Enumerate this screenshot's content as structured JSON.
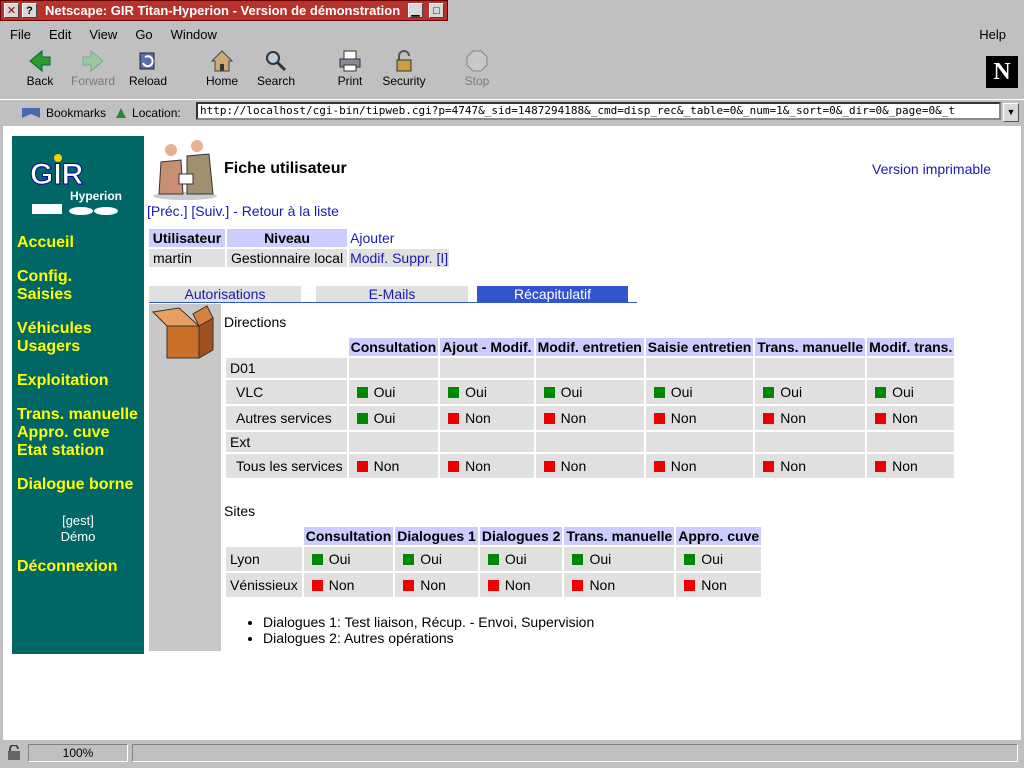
{
  "window": {
    "title": "Netscape: GIR Titan-Hyperion - Version de démonstration"
  },
  "menu": {
    "file": "File",
    "edit": "Edit",
    "view": "View",
    "go": "Go",
    "window": "Window",
    "help": "Help"
  },
  "toolbar": {
    "back": "Back",
    "forward": "Forward",
    "reload": "Reload",
    "home": "Home",
    "search": "Search",
    "print": "Print",
    "security": "Security",
    "stop": "Stop"
  },
  "location": {
    "bookmarks": "Bookmarks",
    "label": "Location:",
    "url": "http://localhost/cgi-bin/tipweb.cgi?p=4747&_sid=1487294188&_cmd=disp_rec&_table=0&_num=1&_sort=0&_dir=0&_page=0&_t"
  },
  "sidebar": {
    "logo_text": "GIR",
    "logo_sub": "Hyperion",
    "links": [
      "Accueil",
      "Config.",
      "Saisies",
      "Véhicules",
      "Usagers",
      "Exploitation",
      "Trans. manuelle",
      "Appro. cuve",
      "Etat station",
      "Dialogue borne",
      "Déconnexion"
    ],
    "user_line1": "[gest]",
    "user_line2": "Démo"
  },
  "page": {
    "title": "Fiche utilisateur",
    "printable": "Version imprimable",
    "nav": {
      "prev": "[Préc.]",
      "next": "[Suiv.]",
      "sep": " - ",
      "back": "Retour à la liste"
    }
  },
  "user_table": {
    "h_user": "Utilisateur",
    "h_level": "Niveau",
    "add": "Ajouter",
    "user": "martin",
    "level": "Gestionnaire local",
    "modify": "Modif.",
    "delete": "Suppr.",
    "info": "[I]"
  },
  "tabs": [
    "Autorisations",
    "E-Mails",
    "Récapitulatif"
  ],
  "directions": {
    "title": "Directions",
    "headers": [
      "Consultation",
      "Ajout - Modif.",
      "Modif. entretien",
      "Saisie entretien",
      "Trans. manuelle",
      "Modif. trans."
    ],
    "groups": [
      {
        "name": "D01",
        "rows": [
          {
            "label": "VLC",
            "values": [
              "Oui",
              "Oui",
              "Oui",
              "Oui",
              "Oui",
              "Oui"
            ]
          },
          {
            "label": "Autres services",
            "values": [
              "Oui",
              "Non",
              "Non",
              "Non",
              "Non",
              "Non"
            ]
          }
        ]
      },
      {
        "name": "Ext",
        "rows": [
          {
            "label": "Tous les services",
            "values": [
              "Non",
              "Non",
              "Non",
              "Non",
              "Non",
              "Non"
            ]
          }
        ]
      }
    ]
  },
  "sites": {
    "title": "Sites",
    "headers": [
      "Consultation",
      "Dialogues 1",
      "Dialogues 2",
      "Trans. manuelle",
      "Appro. cuve"
    ],
    "rows": [
      {
        "label": "Lyon",
        "values": [
          "Oui",
          "Oui",
          "Oui",
          "Oui",
          "Oui"
        ]
      },
      {
        "label": "Vénissieux",
        "values": [
          "Non",
          "Non",
          "Non",
          "Non",
          "Non"
        ]
      }
    ]
  },
  "notes": [
    "Dialogues 1: Test liaison, Récup. - Envoi, Supervision",
    "Dialogues 2: Autres opérations"
  ],
  "status": {
    "zoom": "100%"
  },
  "colors": {
    "yes": "#008800",
    "no": "#ee0000",
    "sidebar": "#006666",
    "link_yellow": "#ffff00",
    "header_bg": "#ccccff"
  }
}
